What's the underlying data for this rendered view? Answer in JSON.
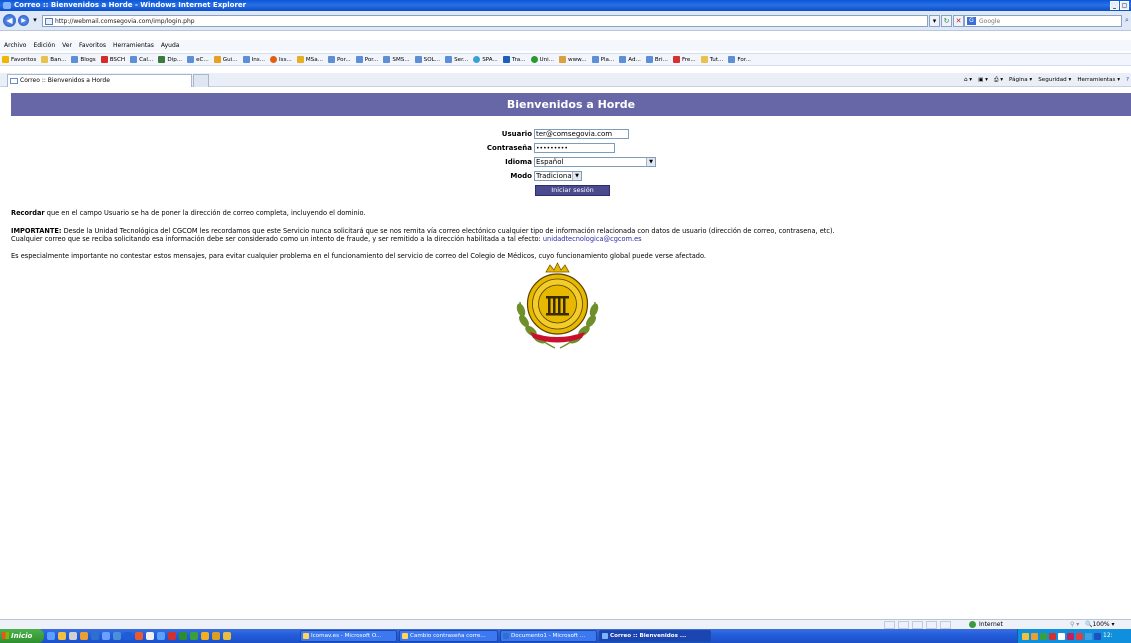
{
  "window": {
    "title": "Correo :: Bienvenidos a Horde - Windows Internet Explorer",
    "controls": [
      "_",
      "▢"
    ]
  },
  "address_bar": {
    "url": "http://webmail.comsegovia.com/imp/login.php",
    "search_placeholder": "Google"
  },
  "menu": [
    "Archivo",
    "Edición",
    "Ver",
    "Favoritos",
    "Herramientas",
    "Ayuda"
  ],
  "favorites": {
    "label": "Favoritos",
    "items": [
      "Ban...",
      "Blogs",
      "BSCH",
      "Cal...",
      "Dip...",
      "eC...",
      "Gui...",
      "Ins...",
      "Iss...",
      "MSa...",
      "Por...",
      "Por...",
      "SMS...",
      "SOL...",
      "Ser...",
      "SPA...",
      "Tra...",
      "Uni...",
      "www...",
      "Pla...",
      "Ad...",
      "Bri...",
      "Fre...",
      "Tut...",
      "For..."
    ]
  },
  "tab": {
    "label": "Correo :: Bienvenidos a Horde"
  },
  "command_bar": [
    "Página",
    "Seguridad",
    "Herramientas"
  ],
  "page": {
    "header": "Bienvenidos a Horde",
    "form": {
      "user_label": "Usuario",
      "user_value": "ter@comsegovia.com",
      "password_label": "Contraseña",
      "password_value": "•••••••••",
      "language_label": "Idioma",
      "language_value": "Español",
      "mode_label": "Modo",
      "mode_value": "Tradicional",
      "login_button": "Iniciar sesión"
    },
    "remember_bold": "Recordar",
    "remember_text": " que en el campo Usuario se ha de poner la dirección de correo completa, incluyendo el dominio.",
    "important_bold": "IMPORTANTE:",
    "important_text": " Desde la Unidad Tecnológica del CGCOM les recordamos que este Servicio nunca solicitará que se nos remita vía correo electónico cualquier tipo de información relacionada con datos de usuario (dirección de correo, contrasena, etc).",
    "fraud_text": "Cualquier correo que se reciba solicitando esa información debe ser considerado como un intento de fraude, y ser remitido a la dirección habilitada a tal efecto: ",
    "fraud_email": "unidadtecnologica@cgcom.es",
    "warning_text": "Es especialmente importante no contestar estos mensajes, para evitar cualquier problema en el funcionamiento del servicio de correo del Colegio de Médicos, cuyo funcionamiento global puede verse afectado."
  },
  "status_bar": {
    "zone": "Internet",
    "zoom": "100%"
  },
  "taskbar": {
    "start": "Inicio",
    "tasks": [
      "Icomav.es - Microsoft O...",
      "Cambio contraseña corre...",
      "Documento1 - Microsoft ...",
      "Correo :: Bienvenidos ..."
    ],
    "clock": "12:"
  },
  "colors": {
    "header_bg": "#6767a8",
    "button_bg": "#4a4a8e",
    "link": "#2b2ba8",
    "logo_gold": "#e6b800",
    "logo_green": "#6f8f2a"
  }
}
